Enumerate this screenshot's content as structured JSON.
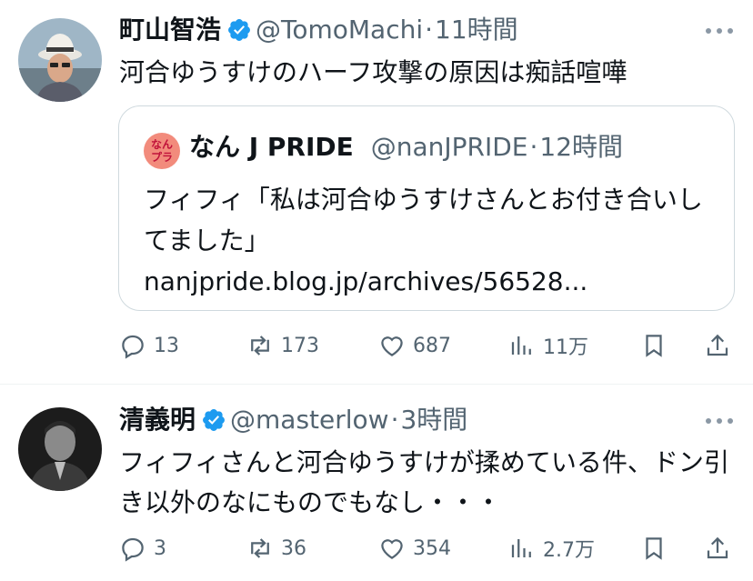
{
  "tweets": [
    {
      "author_name": "町山智浩",
      "handle": "@TomoMachi",
      "separator": "·",
      "time": "11時間",
      "text": "河合ゆうすけのハーフ攻撃の原因は痴話喧嘩",
      "quote": {
        "avatar_text_1": "なん",
        "avatar_text_2": "プラ",
        "author_name": "なん J PRIDE",
        "handle": "@nanJPRIDE",
        "separator": "·",
        "time": "12時間",
        "text": "フィフィ「私は河合ゆうすけさんとお付き合いしてました」 nanjpride.blog.jp/archives/56528..."
      },
      "replies": "13",
      "reposts": "173",
      "likes": "687",
      "views": "11万"
    },
    {
      "author_name": "清義明",
      "handle": "@masterlow",
      "separator": "·",
      "time": "3時間",
      "text": "フィフィさんと河合ゆうすけが揉めている件、ドン引き以外のなにものでもなし・・・",
      "replies": "3",
      "reposts": "36",
      "likes": "354",
      "views": "2.7万"
    }
  ],
  "colors": {
    "text": "#0f1419",
    "secondary": "#536471",
    "verified": "#1d9bf0",
    "border": "#cfd9de"
  },
  "icons": [
    "verified-badge-icon",
    "more-icon",
    "reply-icon",
    "repost-icon",
    "like-icon",
    "views-icon",
    "bookmark-icon",
    "share-icon"
  ]
}
